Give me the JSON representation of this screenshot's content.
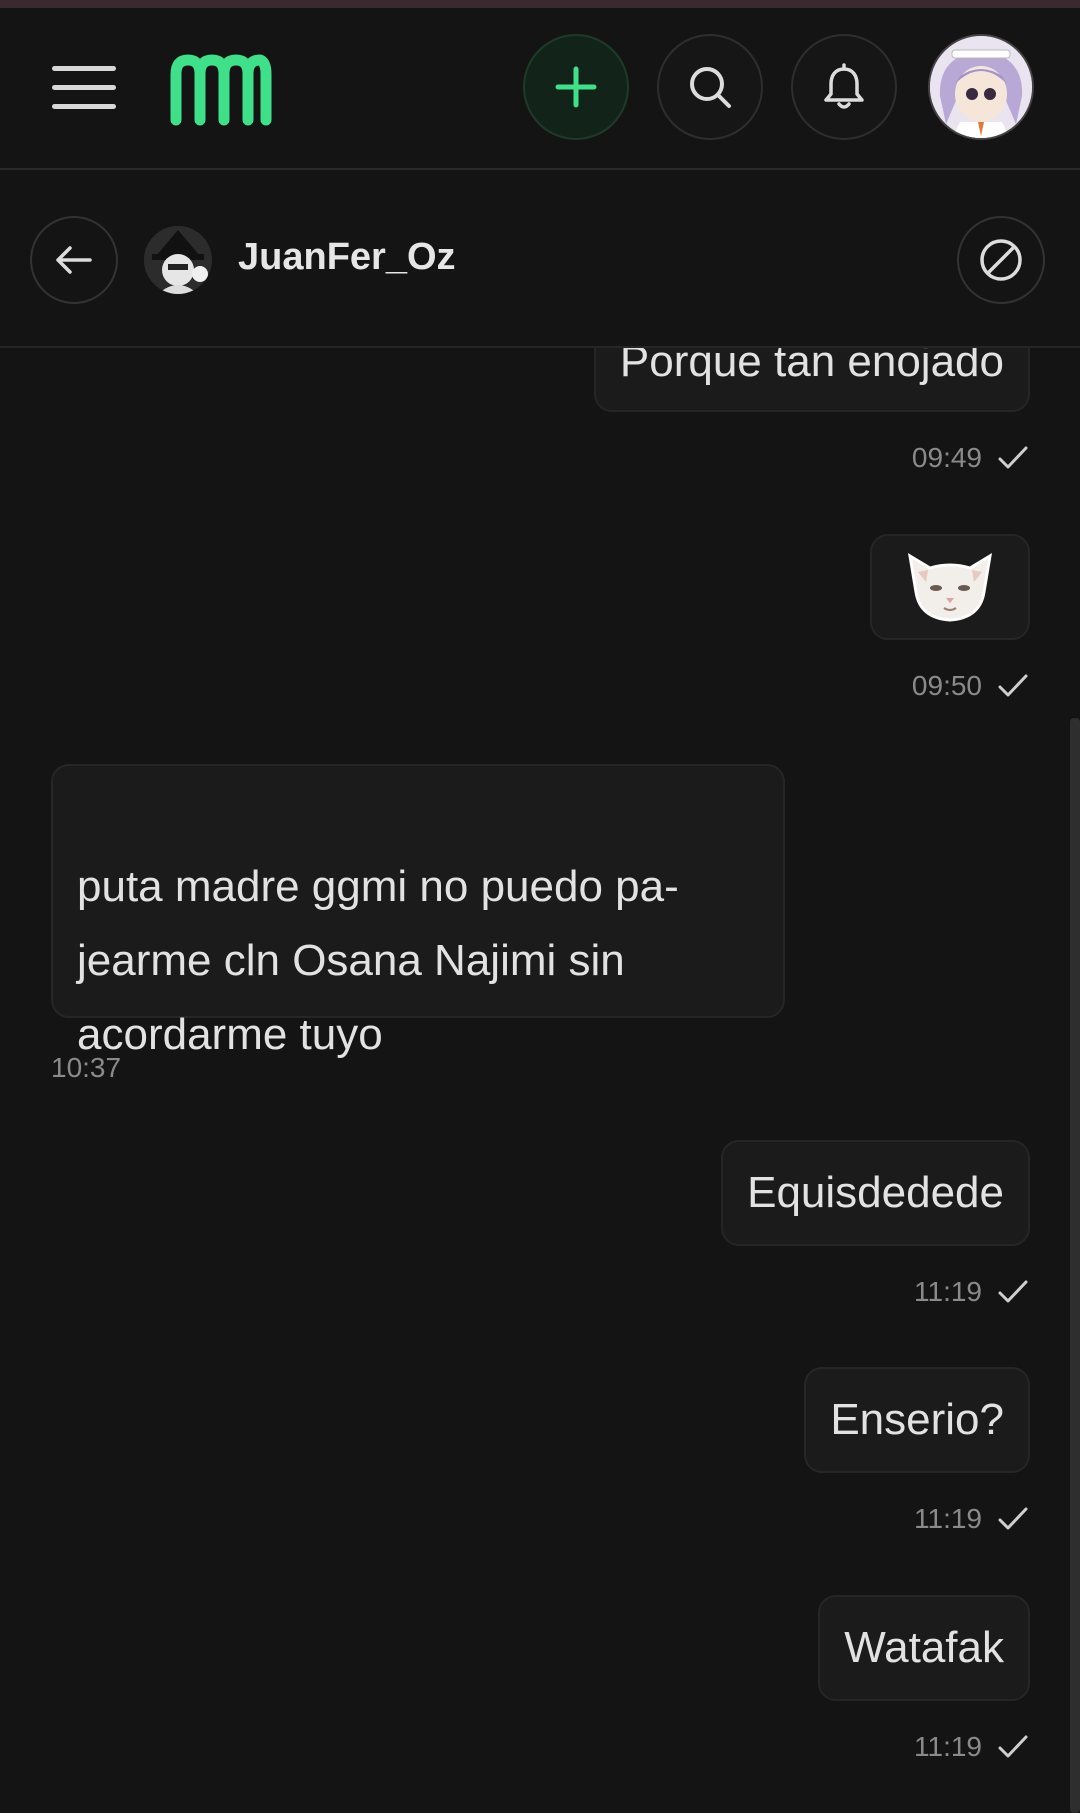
{
  "topbar": {
    "menu_icon": "hamburger-menu-icon",
    "logo": "mm-logo",
    "add_icon": "plus-icon",
    "search_icon": "search-icon",
    "bell_icon": "bell-icon",
    "accent": "#3ee08a"
  },
  "chat": {
    "contact_name": "JuanFer_Oz",
    "back_icon": "arrow-left-icon",
    "block_icon": "block-icon"
  },
  "messages": [
    {
      "side": "right",
      "text": "Porque tan enojado",
      "time": "09:49",
      "read": true
    },
    {
      "side": "right",
      "sticker": "white-cat-sticker",
      "time": "09:50",
      "read": true
    },
    {
      "side": "left",
      "text": "puta madre ggmi no puedo pa-\njearme cln Osana Najimi sin\nacordarme tuyo",
      "time": "10:37"
    },
    {
      "side": "right",
      "text": "Equisdedede",
      "time": "11:19",
      "read": true
    },
    {
      "side": "right",
      "text": "Enserio?",
      "time": "11:19",
      "read": true
    },
    {
      "side": "right",
      "text": "Watafak",
      "time": "11:19",
      "read": true
    }
  ]
}
